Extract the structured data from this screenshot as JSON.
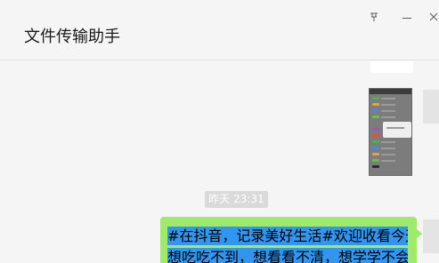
{
  "header": {
    "chat_title": "文件传输助手",
    "pin_icon": "pin-icon",
    "minimize_icon": "minimize-icon",
    "close_icon": "close-icon"
  },
  "messages": {
    "timestamp": "昨天 23:31",
    "image_message": "phone-screenshot-thumbnail",
    "text_message": {
      "line1": "#在抖音，记录美好生活#欢迎收看今天的“",
      "line2": "想吃吃不到，想看看不清，想学学不会”美"
    }
  },
  "colors": {
    "background": "#f5f5f5",
    "bubble_green": "#9eea6a",
    "selection_blue": "#3296f0",
    "timestamp_bg": "#dadada"
  }
}
